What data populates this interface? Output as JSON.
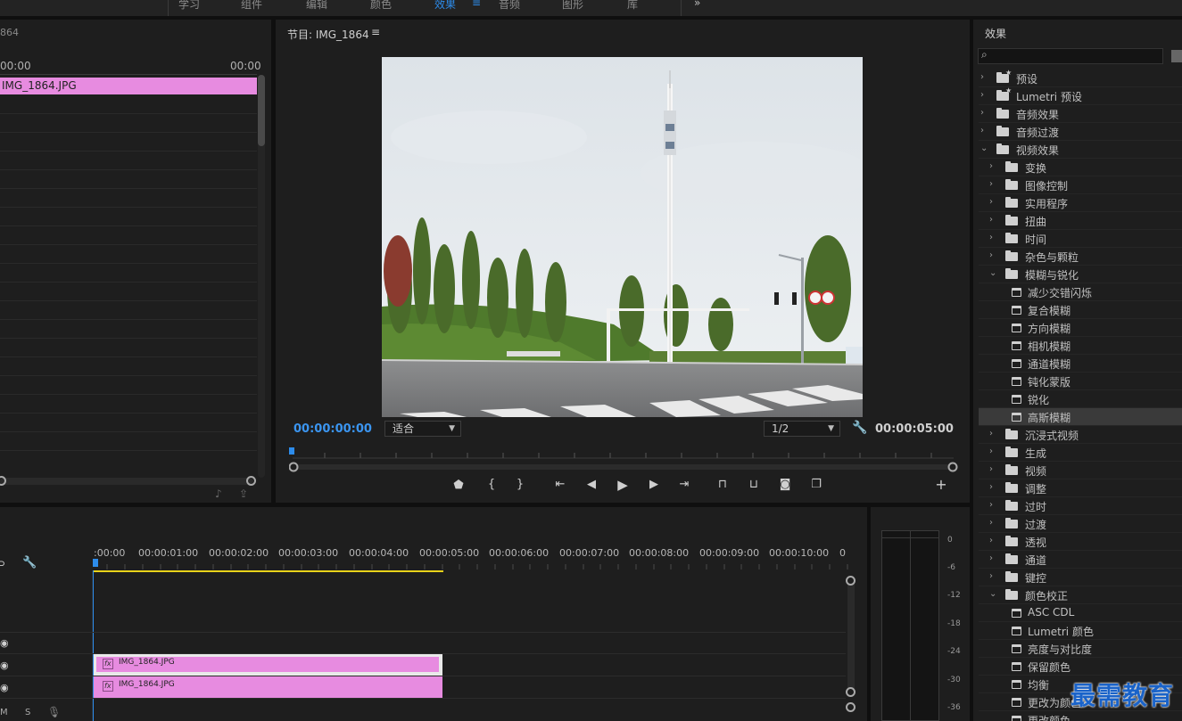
{
  "workspace_tabs": [
    "学习",
    "组件",
    "编辑",
    "颜色",
    "效果",
    "音频",
    "图形",
    "库"
  ],
  "active_tab_index": 4,
  "source": {
    "title_fragment": "864",
    "time_left": "00:00",
    "time_right": "00:00",
    "clip_name": "IMG_1864.JPG"
  },
  "program": {
    "title": "节目: IMG_1864",
    "menu_icon": "≡",
    "timecode_current": "00:00:00:00",
    "fit_label": "适合",
    "resolution": "1/2",
    "timecode_duration": "00:00:05:00"
  },
  "timeline": {
    "ruler_labels": [
      ":00:00",
      "00:00:01:00",
      "00:00:02:00",
      "00:00:03:00",
      "00:00:04:00",
      "00:00:05:00",
      "00:00:06:00",
      "00:00:07:00",
      "00:00:08:00",
      "00:00:09:00",
      "00:00:10:00",
      "0"
    ],
    "clip_v2": "IMG_1864.JPG",
    "clip_v1": "IMG_1864.JPG",
    "fx_badge": "fx",
    "track_letters": [
      "M",
      "S"
    ]
  },
  "meter": {
    "db_labels": [
      "0",
      "-6",
      "-12",
      "-18",
      "-24",
      "-30",
      "-36"
    ]
  },
  "effects": {
    "title": "效果",
    "items": [
      {
        "label": "预设",
        "level": 0,
        "kind": "preset",
        "expanded": false
      },
      {
        "label": "Lumetri 预设",
        "level": 0,
        "kind": "preset",
        "expanded": false
      },
      {
        "label": "音频效果",
        "level": 0,
        "kind": "folder",
        "expanded": false
      },
      {
        "label": "音频过渡",
        "level": 0,
        "kind": "folder",
        "expanded": false
      },
      {
        "label": "视频效果",
        "level": 0,
        "kind": "folder",
        "expanded": true
      },
      {
        "label": "变换",
        "level": 1,
        "kind": "folder",
        "expanded": false
      },
      {
        "label": "图像控制",
        "level": 1,
        "kind": "folder",
        "expanded": false
      },
      {
        "label": "实用程序",
        "level": 1,
        "kind": "folder",
        "expanded": false
      },
      {
        "label": "扭曲",
        "level": 1,
        "kind": "folder",
        "expanded": false
      },
      {
        "label": "时间",
        "level": 1,
        "kind": "folder",
        "expanded": false
      },
      {
        "label": "杂色与颗粒",
        "level": 1,
        "kind": "folder",
        "expanded": false
      },
      {
        "label": "模糊与锐化",
        "level": 1,
        "kind": "folder",
        "expanded": true
      },
      {
        "label": "减少交错闪烁",
        "level": 2,
        "kind": "effect"
      },
      {
        "label": "复合模糊",
        "level": 2,
        "kind": "effect"
      },
      {
        "label": "方向模糊",
        "level": 2,
        "kind": "effect"
      },
      {
        "label": "相机模糊",
        "level": 2,
        "kind": "effect"
      },
      {
        "label": "通道模糊",
        "level": 2,
        "kind": "effect"
      },
      {
        "label": "钝化蒙版",
        "level": 2,
        "kind": "effect"
      },
      {
        "label": "锐化",
        "level": 2,
        "kind": "effect"
      },
      {
        "label": "高斯模糊",
        "level": 2,
        "kind": "effect",
        "selected": true
      },
      {
        "label": "沉浸式视频",
        "level": 1,
        "kind": "folder",
        "expanded": false
      },
      {
        "label": "生成",
        "level": 1,
        "kind": "folder",
        "expanded": false
      },
      {
        "label": "视频",
        "level": 1,
        "kind": "folder",
        "expanded": false
      },
      {
        "label": "调整",
        "level": 1,
        "kind": "folder",
        "expanded": false
      },
      {
        "label": "过时",
        "level": 1,
        "kind": "folder",
        "expanded": false
      },
      {
        "label": "过渡",
        "level": 1,
        "kind": "folder",
        "expanded": false
      },
      {
        "label": "透视",
        "level": 1,
        "kind": "folder",
        "expanded": false
      },
      {
        "label": "通道",
        "level": 1,
        "kind": "folder",
        "expanded": false
      },
      {
        "label": "键控",
        "level": 1,
        "kind": "folder",
        "expanded": false
      },
      {
        "label": "颜色校正",
        "level": 1,
        "kind": "folder",
        "expanded": true
      },
      {
        "label": "ASC CDL",
        "level": 2,
        "kind": "effect"
      },
      {
        "label": "Lumetri 颜色",
        "level": 2,
        "kind": "effect"
      },
      {
        "label": "亮度与对比度",
        "level": 2,
        "kind": "effect"
      },
      {
        "label": "保留颜色",
        "level": 2,
        "kind": "effect"
      },
      {
        "label": "均衡",
        "level": 2,
        "kind": "effect"
      },
      {
        "label": "更改为颜色",
        "level": 2,
        "kind": "effect"
      },
      {
        "label": "更改颜色",
        "level": 2,
        "kind": "effect"
      }
    ]
  },
  "watermark": "最需教育",
  "colors": {
    "accent": "#2d8ceb",
    "clip": "#e78be0",
    "panel": "#1e1e1e",
    "work_area": "#e8d21a"
  }
}
